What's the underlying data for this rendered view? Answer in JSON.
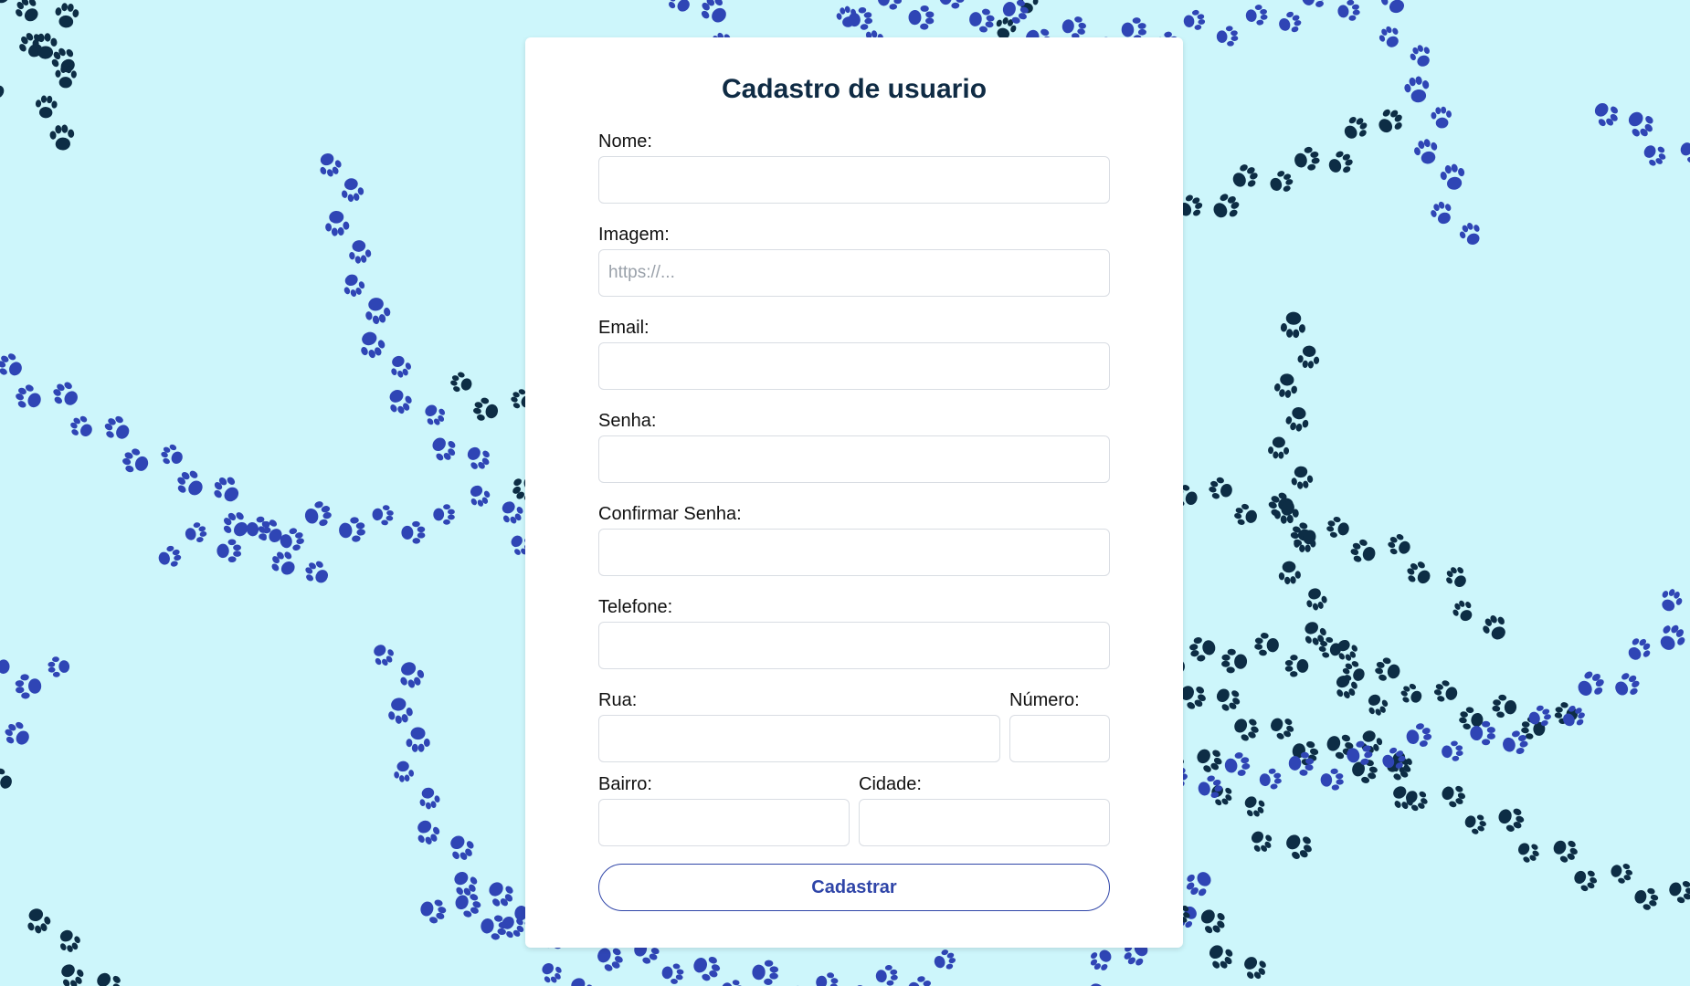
{
  "form": {
    "title": "Cadastro de usuario",
    "fields": {
      "nome": {
        "label": "Nome:",
        "value": "",
        "placeholder": ""
      },
      "imagem": {
        "label": "Imagem:",
        "value": "",
        "placeholder": "https://..."
      },
      "email": {
        "label": "Email:",
        "value": "",
        "placeholder": ""
      },
      "senha": {
        "label": "Senha:",
        "value": "",
        "placeholder": ""
      },
      "confirmar_senha": {
        "label": "Confirmar Senha:",
        "value": "",
        "placeholder": ""
      },
      "telefone": {
        "label": "Telefone:",
        "value": "",
        "placeholder": ""
      },
      "rua": {
        "label": "Rua:",
        "value": "",
        "placeholder": ""
      },
      "numero": {
        "label": "Número:",
        "value": "",
        "placeholder": ""
      },
      "bairro": {
        "label": "Bairro:",
        "value": "",
        "placeholder": ""
      },
      "cidade": {
        "label": "Cidade:",
        "value": "",
        "placeholder": ""
      }
    },
    "submit_label": "Cadastrar"
  },
  "background": {
    "color": "#cdf6fb",
    "pattern_icon": "paw-print-icon",
    "paw_colors": [
      "#0d2d45",
      "#2f45b5"
    ]
  }
}
